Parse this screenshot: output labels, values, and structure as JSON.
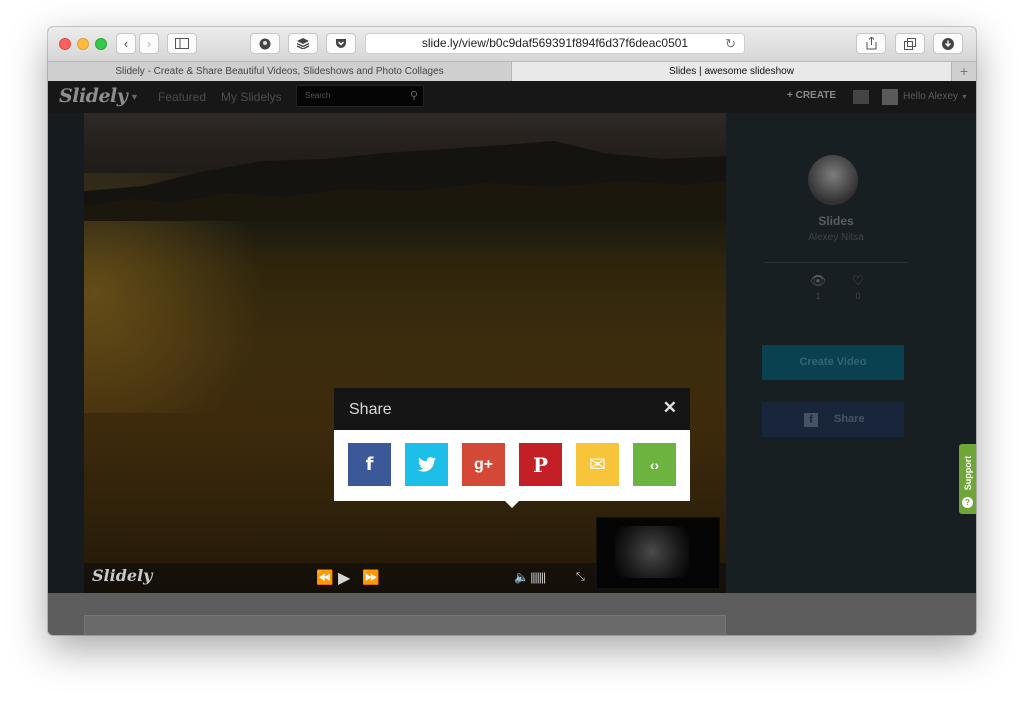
{
  "browser": {
    "address": "slide.ly/view/b0c9daf569391f894f6d37f6deac0501",
    "tabs": [
      {
        "label": "Slidely - Create & Share Beautiful Videos, Slideshows and Photo Collages",
        "active": false
      },
      {
        "label": "Slides | awesome slideshow",
        "active": true
      }
    ]
  },
  "site": {
    "logo": "Slidely",
    "nav": [
      "Featured",
      "My Slidelys"
    ],
    "search_placeholder": "Search",
    "create_label": "+ CREATE",
    "greeting": "Hello Alexey"
  },
  "player": {
    "logo": "Slidely"
  },
  "sidebar": {
    "title": "Slides",
    "author": "Alexey Nitsa",
    "views": "1",
    "likes": "0",
    "create_video": "Create Video",
    "share": "Share",
    "support": "Support"
  },
  "share_modal": {
    "title": "Share",
    "buttons": [
      {
        "name": "facebook",
        "glyph": "f",
        "color": "#3b5998"
      },
      {
        "name": "twitter",
        "glyph": "🐦",
        "color": "#1dbee8"
      },
      {
        "name": "google-plus",
        "glyph": "g+",
        "color": "#d34836"
      },
      {
        "name": "pinterest",
        "glyph": "P",
        "color": "#c41f26"
      },
      {
        "name": "email",
        "glyph": "✉",
        "color": "#f8c53a"
      },
      {
        "name": "embed",
        "glyph": "‹›",
        "color": "#6db33f"
      }
    ]
  }
}
